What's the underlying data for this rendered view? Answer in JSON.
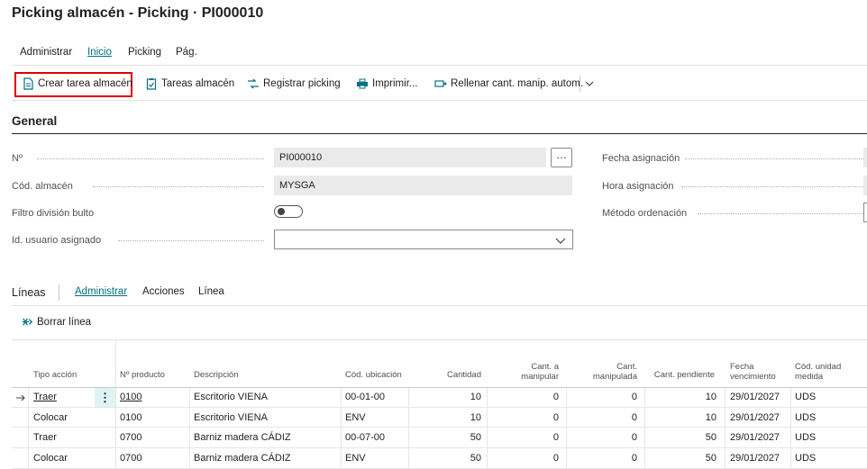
{
  "page": {
    "title": "Picking almacén - Picking · PI000010",
    "menu": [
      {
        "label": "Administrar"
      },
      {
        "label": "Inicio"
      },
      {
        "label": "Picking"
      },
      {
        "label": "Pág."
      }
    ],
    "toolbar": {
      "create_task": "Crear tarea almacén",
      "warehouse_tasks": "Tareas almacén",
      "register_picking": "Registrar picking",
      "print": "Imprimir...",
      "autofill": "Rellenar cant. manip. autom."
    },
    "colors": {
      "accent": "#00707f",
      "highlight": "#e00000"
    }
  },
  "general": {
    "title": "General",
    "no_label": "Nº",
    "no_value": "PI000010",
    "warehouse_label": "Cód. almacén",
    "warehouse_value": "MYSGA",
    "filter_label": "Filtro división bulto",
    "filter_on": false,
    "user_label": "Id. usuario asignado",
    "user_value": "",
    "assign_date_label": "Fecha asignación",
    "assign_time_label": "Hora asignación",
    "sort_method_label": "Método ordenación"
  },
  "lines": {
    "title": "Líneas",
    "tabs": [
      "Administrar",
      "Acciones",
      "Línea"
    ],
    "delete_line": "Borrar línea",
    "headers": {
      "action": "Tipo acción",
      "item": "Nº producto",
      "desc": "Descripción",
      "bin": "Cód. ubicación",
      "qty": "Cantidad",
      "to_handle_1": "Cant. a",
      "to_handle_2": "manipular",
      "handled_1": "Cant.",
      "handled_2": "manipulada",
      "pending": "Cant. pendiente",
      "expiry_1": "Fecha",
      "expiry_2": "vencimiento",
      "uom_1": "Cód. unidad",
      "uom_2": "medida"
    },
    "rows": [
      {
        "action": "Traer",
        "item": "0100",
        "desc": "Escritorio VIENA",
        "bin": "00-01-00",
        "qty": "10",
        "to_handle": "0",
        "handled": "0",
        "pending": "10",
        "expiry": "29/01/2027",
        "uom": "UDS"
      },
      {
        "action": "Colocar",
        "item": "0100",
        "desc": "Escritorio VIENA",
        "bin": "ENV",
        "qty": "10",
        "to_handle": "0",
        "handled": "0",
        "pending": "10",
        "expiry": "29/01/2027",
        "uom": "UDS"
      },
      {
        "action": "Traer",
        "item": "0700",
        "desc": "Barniz madera CÁDIZ",
        "bin": "00-07-00",
        "qty": "50",
        "to_handle": "0",
        "handled": "0",
        "pending": "50",
        "expiry": "29/01/2027",
        "uom": "UDS"
      },
      {
        "action": "Colocar",
        "item": "0700",
        "desc": "Barniz madera CÁDIZ",
        "bin": "ENV",
        "qty": "50",
        "to_handle": "0",
        "handled": "0",
        "pending": "50",
        "expiry": "29/01/2027",
        "uom": "UDS"
      }
    ]
  }
}
